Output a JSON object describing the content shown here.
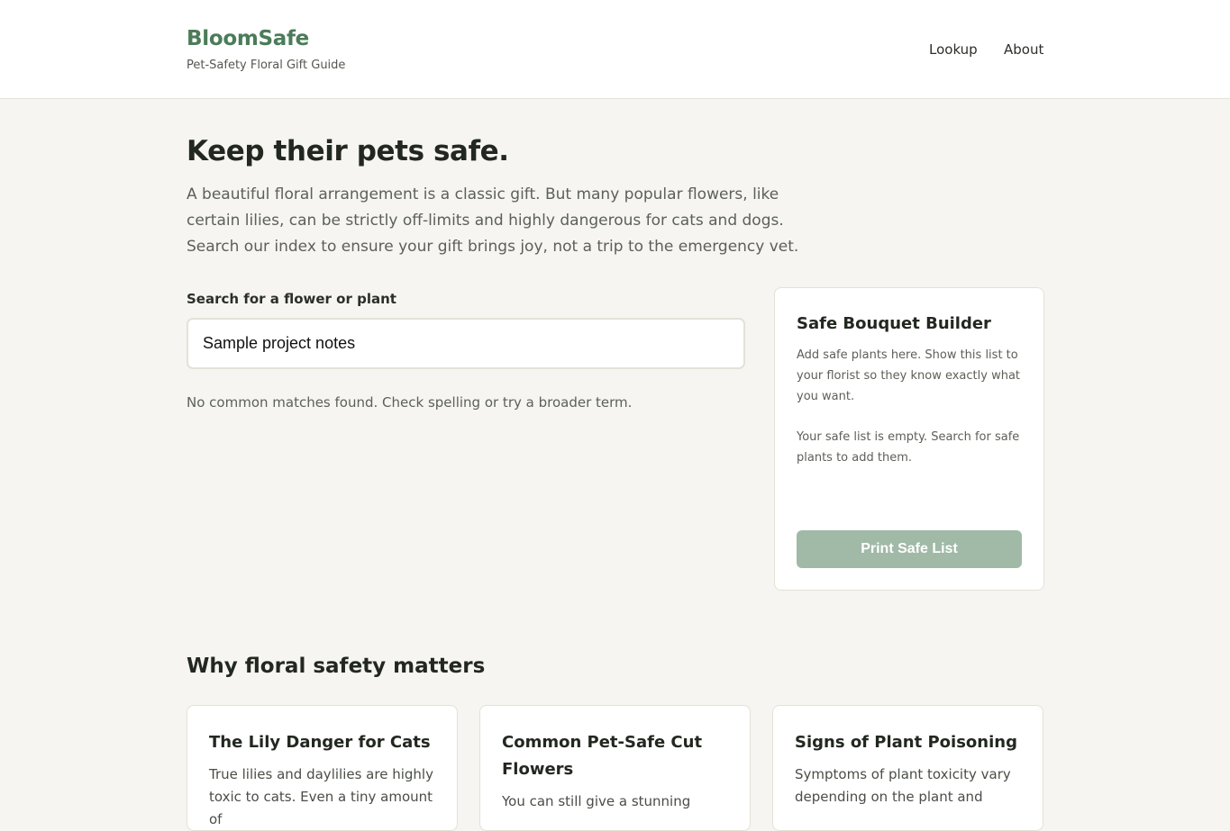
{
  "header": {
    "brand_name": "BloomSafe",
    "tagline": "Pet-Safety Floral Gift Guide",
    "nav": [
      {
        "label": "Lookup"
      },
      {
        "label": "About"
      }
    ]
  },
  "hero": {
    "title": "Keep their pets safe.",
    "text": "A beautiful floral arrangement is a classic gift. But many popular flowers, like certain lilies, can be strictly off-limits and highly dangerous for cats and dogs. Search our index to ensure your gift brings joy, not a trip to the emergency vet."
  },
  "search": {
    "label": "Search for a flower or plant",
    "value": "Sample project notes",
    "status": "No common matches found. Check spelling or try a broader term."
  },
  "builder": {
    "title": "Safe Bouquet Builder",
    "description": "Add safe plants here. Show this list to your florist so they know exactly what you want.",
    "empty_text": "Your safe list is empty. Search for safe plants to add them.",
    "print_label": "Print Safe List"
  },
  "info": {
    "section_title": "Why floral safety matters",
    "cards": [
      {
        "title": "The Lily Danger for Cats",
        "text": "True lilies and daylilies are highly toxic to cats. Even a tiny amount of"
      },
      {
        "title": "Common Pet-Safe Cut Flowers",
        "text": "You can still give a stunning"
      },
      {
        "title": "Signs of Plant Poisoning",
        "text": "Symptoms of plant toxicity vary depending on the plant and"
      }
    ]
  },
  "colors": {
    "brand": "#4b7c58",
    "background": "#f6f5f1",
    "button_disabled": "#a1b9a7"
  }
}
